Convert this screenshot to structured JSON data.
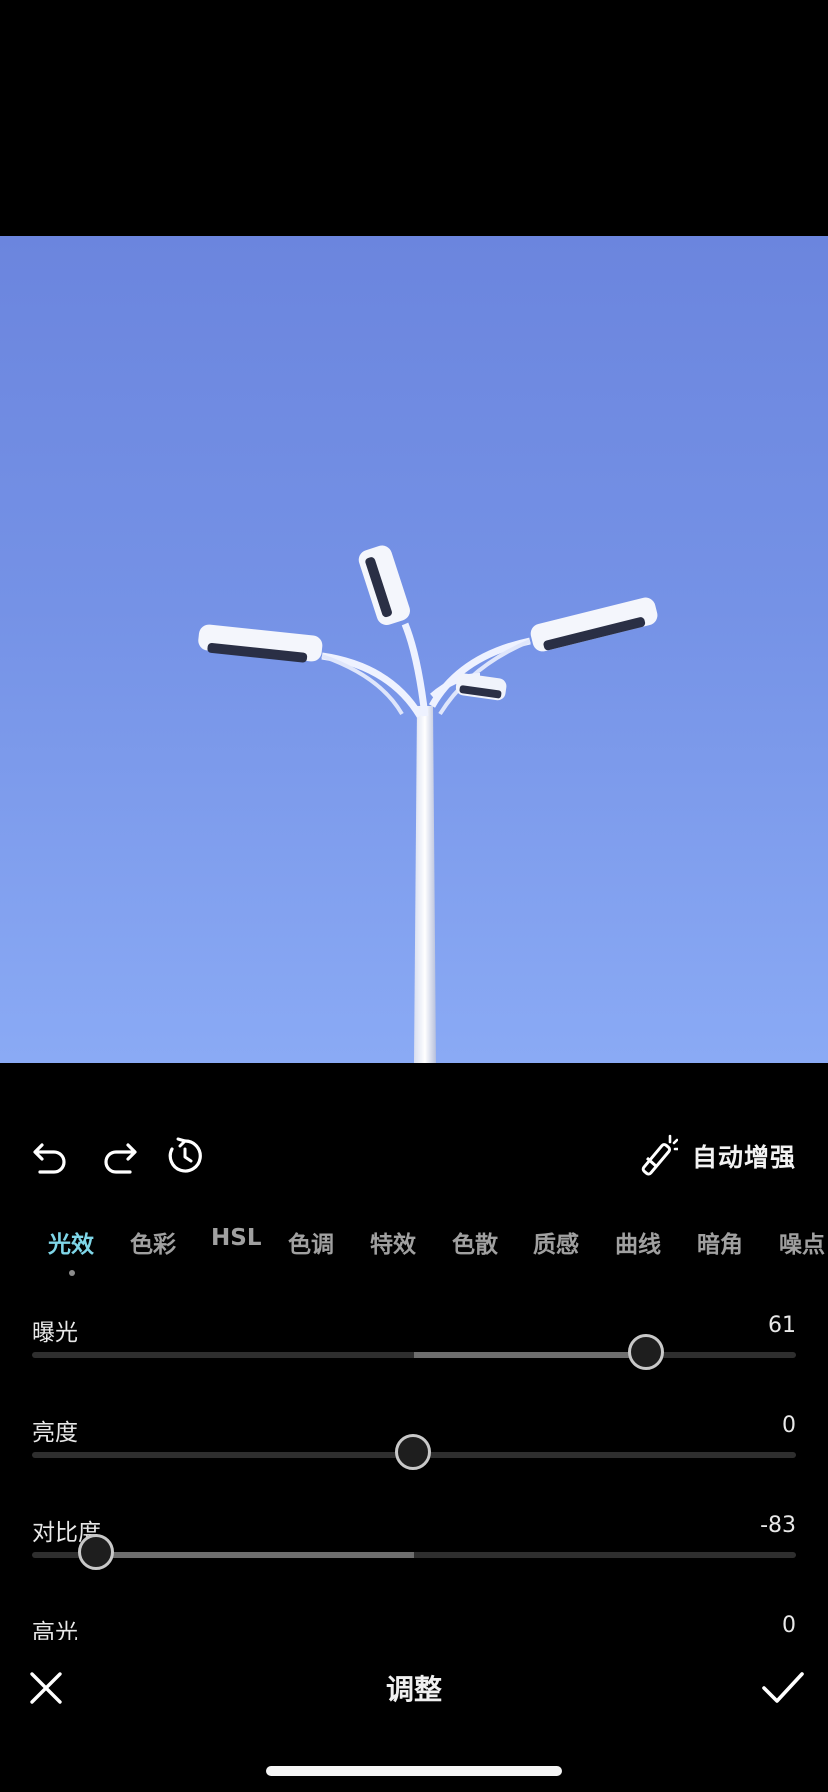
{
  "toolbar": {
    "undo_icon": "undo-icon",
    "redo_icon": "redo-icon",
    "history_icon": "history-reset-icon",
    "auto_enhance_label": "自动增强",
    "auto_enhance_icon": "magic-wand-icon"
  },
  "tabs": [
    {
      "label": "光效",
      "active": true
    },
    {
      "label": "色彩",
      "active": false
    },
    {
      "label": "HSL",
      "active": false
    },
    {
      "label": "色调",
      "active": false
    },
    {
      "label": "特效",
      "active": false
    },
    {
      "label": "色散",
      "active": false
    },
    {
      "label": "质感",
      "active": false
    },
    {
      "label": "曲线",
      "active": false
    },
    {
      "label": "暗角",
      "active": false
    },
    {
      "label": "噪点",
      "active": false
    }
  ],
  "sliders": [
    {
      "label": "曝光",
      "value": "61",
      "numeric": 61
    },
    {
      "label": "亮度",
      "value": "0",
      "numeric": 0
    },
    {
      "label": "对比度",
      "value": "-83",
      "numeric": -83
    },
    {
      "label": "高光",
      "value": "0",
      "numeric": 0
    }
  ],
  "slider_range": [
    -100,
    100
  ],
  "bottom_bar": {
    "title": "调整",
    "cancel_icon": "close-icon",
    "confirm_icon": "checkmark-icon"
  },
  "colors": {
    "accent": "#7fd6e8",
    "sky_top": "#6b85de",
    "sky_bottom": "#8aaaf5",
    "background": "#000000"
  }
}
